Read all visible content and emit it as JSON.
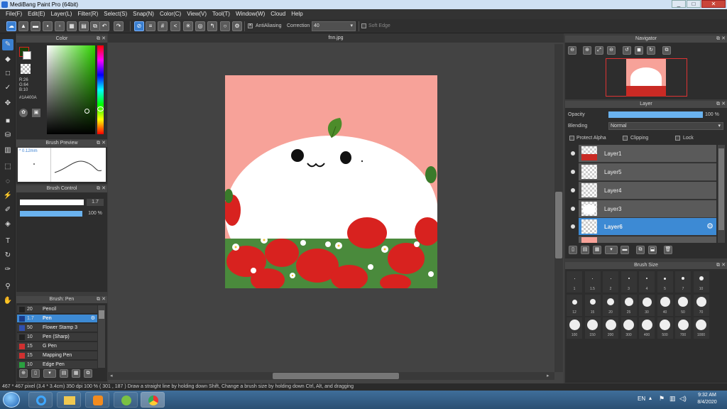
{
  "window": {
    "title": "MediBang Paint Pro (64bit)",
    "min": "_",
    "max": "□",
    "close": "✕"
  },
  "menu": [
    "File(F)",
    "Edit(E)",
    "Layer(L)",
    "Filter(R)",
    "Select(S)",
    "Snap(N)",
    "Color(C)",
    "View(V)",
    "Tool(T)",
    "Window(W)",
    "Cloud",
    "Help"
  ],
  "toolbar": {
    "antialiasing_label": "AntiAliasing",
    "correction_label": "Correction",
    "correction_value": "40",
    "soft_edge_label": "Soft Edge"
  },
  "color_panel": {
    "title": "Color",
    "r": "R:26",
    "g": "G:64",
    "b": "B:10",
    "hex": "#1A400A"
  },
  "brush_preview": {
    "title": "Brush Preview",
    "size": "* 0.12mm"
  },
  "brush_control": {
    "title": "Brush Control",
    "size_value": "1.7",
    "opacity_value": "100 %"
  },
  "brush_list": {
    "title": "Brush: Pen",
    "items": [
      {
        "size": "20",
        "name": "Pencil",
        "color": "#222222"
      },
      {
        "size": "1.7",
        "name": "Pen",
        "color": "#1a3c8a"
      },
      {
        "size": "50",
        "name": "Flower Stamp 3",
        "color": "#3050b0"
      },
      {
        "size": "10",
        "name": "Pen (Sharp)",
        "color": "#222222"
      },
      {
        "size": "15",
        "name": "G Pen",
        "color": "#d03030"
      },
      {
        "size": "15",
        "name": "Mapping Pen",
        "color": "#d03030"
      },
      {
        "size": "10",
        "name": "Edge Pen",
        "color": "#2aa040"
      }
    ]
  },
  "document": {
    "tab": "fnn.jpg"
  },
  "navigator": {
    "title": "Navigator"
  },
  "layer_panel": {
    "title": "Layer",
    "opacity_label": "Opacity",
    "opacity_value": "100 %",
    "opacity": 1.0,
    "blending_label": "Blending",
    "blending_value": "Normal",
    "protect_alpha": "Protect Alpha",
    "clipping": "Clipping",
    "lock": "Lock",
    "layers": [
      "Layer1",
      "Layer5",
      "Layer4",
      "Layer3",
      "Layer6"
    ]
  },
  "brush_size": {
    "title": "Brush Size",
    "rows": [
      [
        "1",
        "1.5",
        "2",
        "3",
        "4",
        "5",
        "7",
        "10"
      ],
      [
        "12",
        "15",
        "20",
        "25",
        "30",
        "40",
        "50",
        "70"
      ],
      [
        "100",
        "150",
        "200",
        "300",
        "400",
        "500",
        "700",
        "1000"
      ]
    ]
  },
  "status": {
    "text": "467 * 467 pixel  (3.4 * 3.4cm)  350 dpi  100 %  ( 301 , 187 )  Draw a straight line by holding down Shift, Change a brush size by holding down Ctrl, Alt, and dragging"
  },
  "taskbar": {
    "lang": "EN",
    "time": "9:32 AM",
    "date": "8/4/2020"
  },
  "colors": {
    "accent": "#3d8ad4",
    "canvas_pink": "#f7a299",
    "primary_color": "#1A400A"
  }
}
